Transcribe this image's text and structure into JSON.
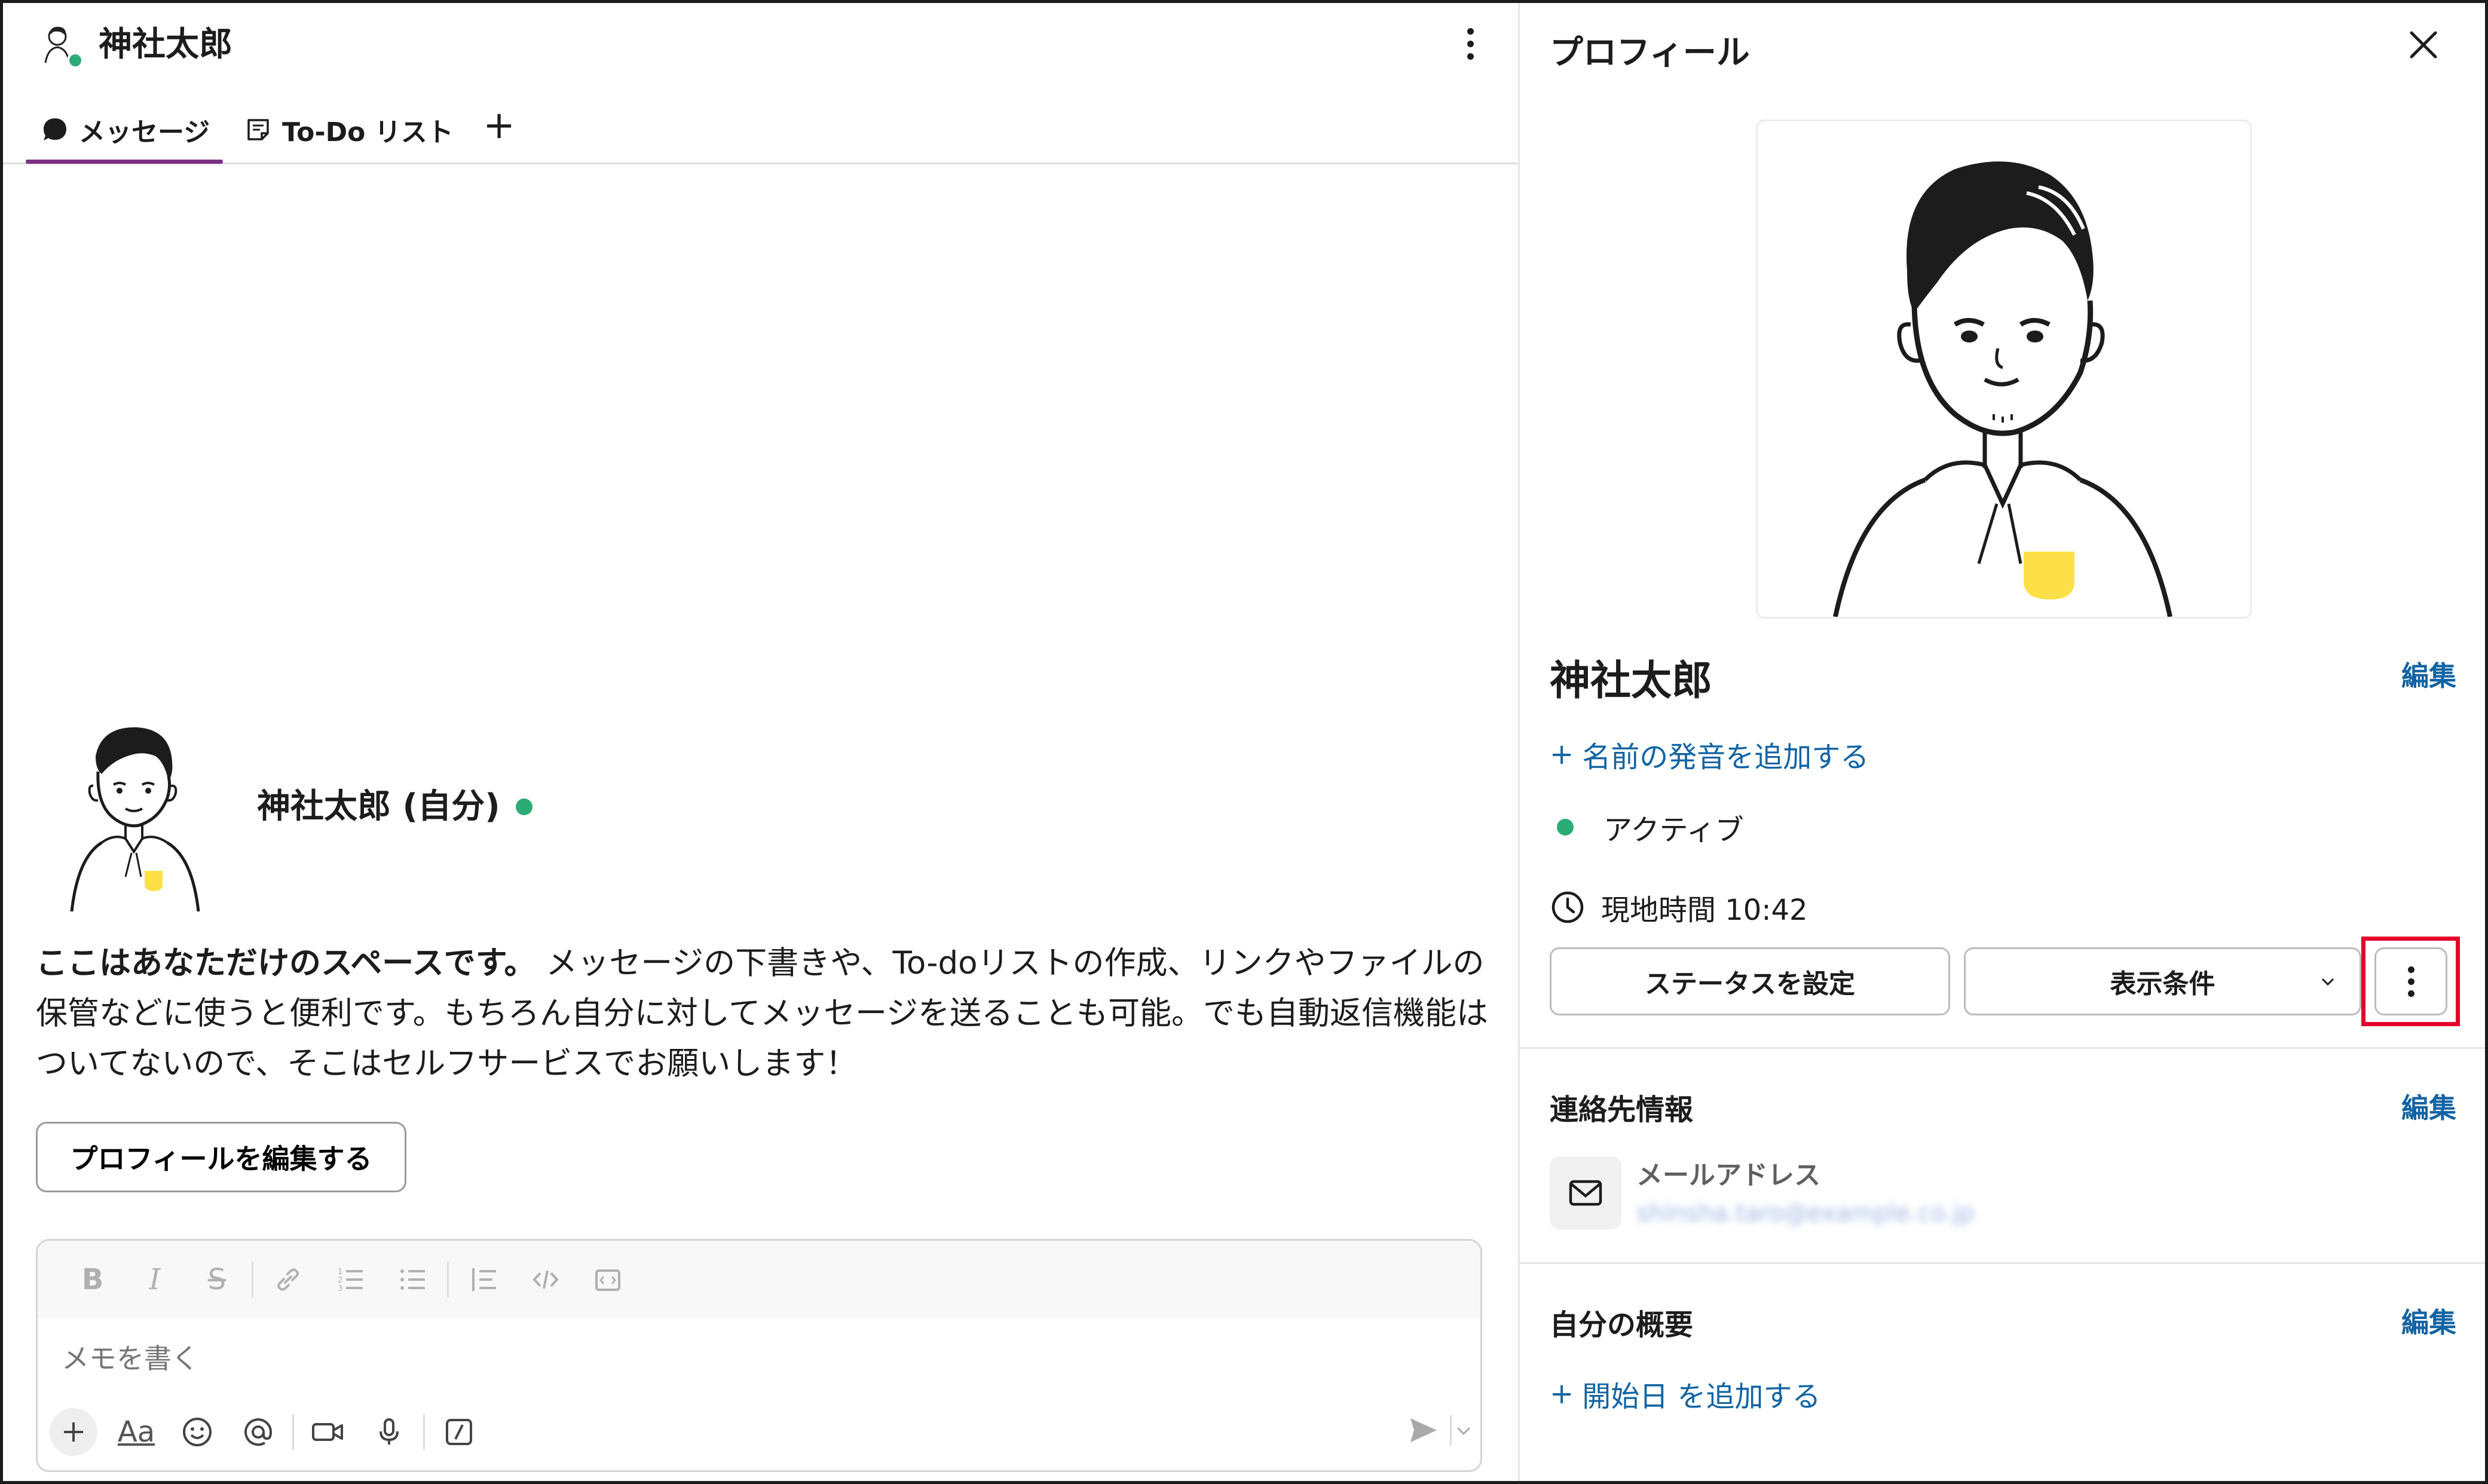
{
  "header": {
    "title": "神社太郎",
    "more_icon": "vertical-ellipsis-icon"
  },
  "tabs": [
    {
      "label": "メッセージ",
      "icon": "message-bubble-icon",
      "active": true
    },
    {
      "label": "To-Do リスト",
      "icon": "note-icon",
      "active": false
    }
  ],
  "tab_add": "+",
  "intro": {
    "name": "神社太郎 (自分)",
    "bold_text": "ここはあなただけのスペースです。",
    "text": " メッセージの下書きや、To-doリストの作成、リンクやファイルの保管などに使うと便利です。もちろん自分に対してメッセージを送ることも可能。でも自動返信機能はついてないので、そこはセルフサービスでお願いします！",
    "edit_profile_button": "プロフィールを編集する"
  },
  "composer": {
    "placeholder": "メモを書く",
    "format_labels": {
      "bold": "B",
      "italic": "I",
      "strike": "S",
      "aa": "Aa",
      "slash": "/"
    }
  },
  "profile": {
    "title": "プロフィール",
    "name": "神社太郎",
    "edit": "編集",
    "add_pronunciation": "名前の発音を追加する",
    "status": "アクティブ",
    "local_time": "現地時間 10:42",
    "set_status_button": "ステータスを設定",
    "view_options_button": "表示条件",
    "contact_title": "連絡先情報",
    "contact_edit": "編集",
    "email_label": "メールアドレス",
    "email_value": "shinsha.taro@example.co.jp",
    "about_title": "自分の概要",
    "about_edit": "編集",
    "add_start_date": "開始日 を追加する",
    "plus": "+"
  },
  "colors": {
    "accent_purple": "#7c3085",
    "link_blue": "#1264a3",
    "presence_green": "#2bac76",
    "highlight_red": "#e4002b",
    "pocket_yellow": "#fde047"
  }
}
